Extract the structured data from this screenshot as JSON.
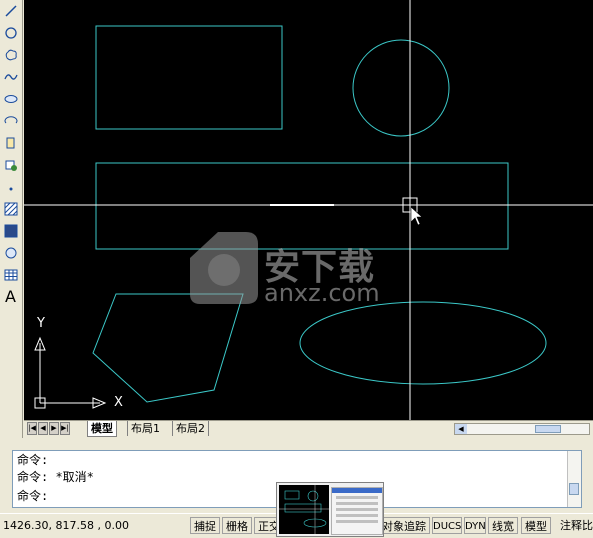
{
  "toolbar": {
    "tools": [
      "line-tool",
      "circle-tool",
      "revcloud-tool",
      "spline-tool",
      "ellipse-tool",
      "ellipse-arc-tool",
      "insert-block-tool",
      "make-block-tool",
      "point-tool",
      "hatch-tool",
      "gradient-tool",
      "region-tool",
      "table-tool",
      "multiline-text-tool"
    ],
    "last_label": "A"
  },
  "canvas": {
    "background": "#000000",
    "shape_color": "#3bc8c8",
    "crosshair_color": "#ffffff",
    "ucs_x_label": "X",
    "ucs_y_label": "Y"
  },
  "layout_tabs": {
    "tabs": [
      "模型",
      "布局1",
      "布局2"
    ],
    "active": "模型"
  },
  "command": {
    "lines": [
      "命令:",
      "命令: *取消*",
      "命令:"
    ]
  },
  "status": {
    "coordinates": "1426.30, 817.58 , 0.00",
    "toggles": [
      "捕捉",
      "栅格",
      "正交",
      "对象追踪",
      "DUCS",
      "DYN",
      "线宽",
      "模型",
      "注释比"
    ]
  },
  "watermark": {
    "title": "安下载",
    "domain": "anxz.com"
  }
}
